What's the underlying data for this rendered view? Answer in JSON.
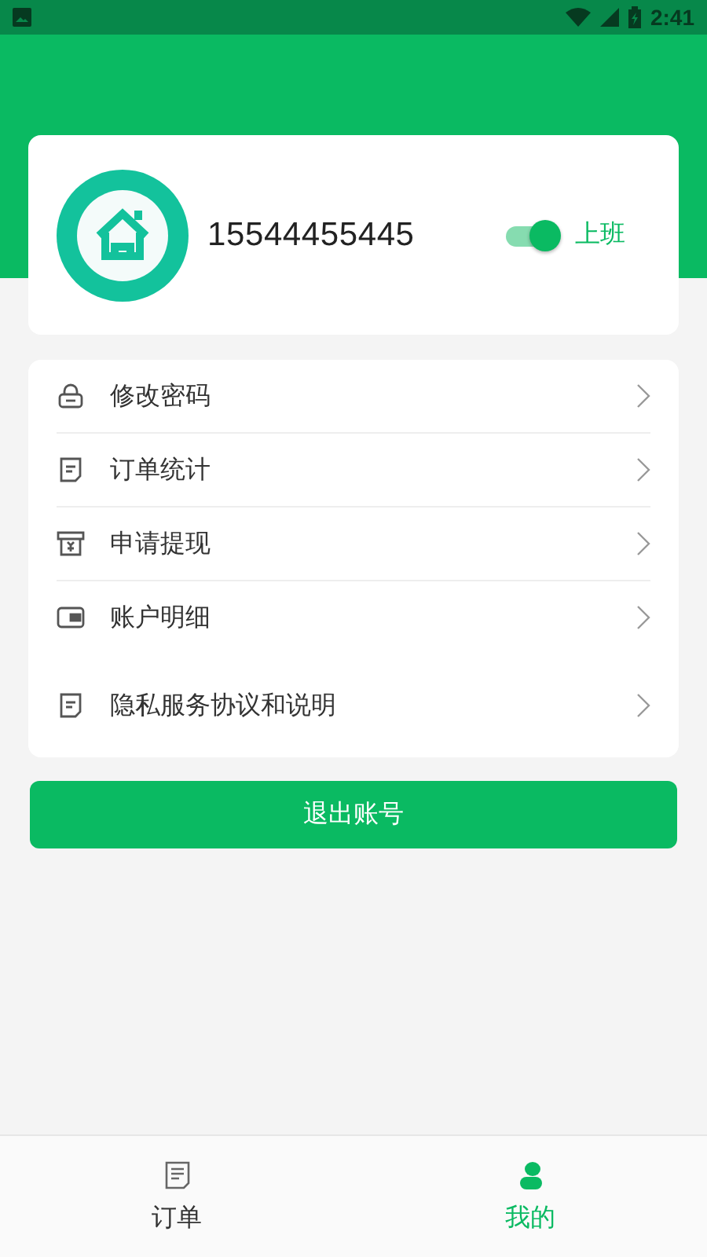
{
  "status_bar": {
    "time": "2:41"
  },
  "profile": {
    "phone": "15544455445",
    "duty_switch": {
      "on": true,
      "label": "上班"
    }
  },
  "menu": [
    {
      "kind": "lock",
      "label": "修改密码"
    },
    {
      "kind": "doc",
      "label": "订单统计"
    },
    {
      "kind": "cash",
      "label": "申请提现"
    },
    {
      "kind": "wallet",
      "label": "账户明细"
    },
    {
      "kind": "doc",
      "label": "隐私服务协议和说明"
    }
  ],
  "logout_button": "退出账号",
  "tabs": [
    {
      "kind": "orders",
      "label": "订单",
      "selected": false
    },
    {
      "kind": "me",
      "label": "我的",
      "selected": true
    }
  ]
}
